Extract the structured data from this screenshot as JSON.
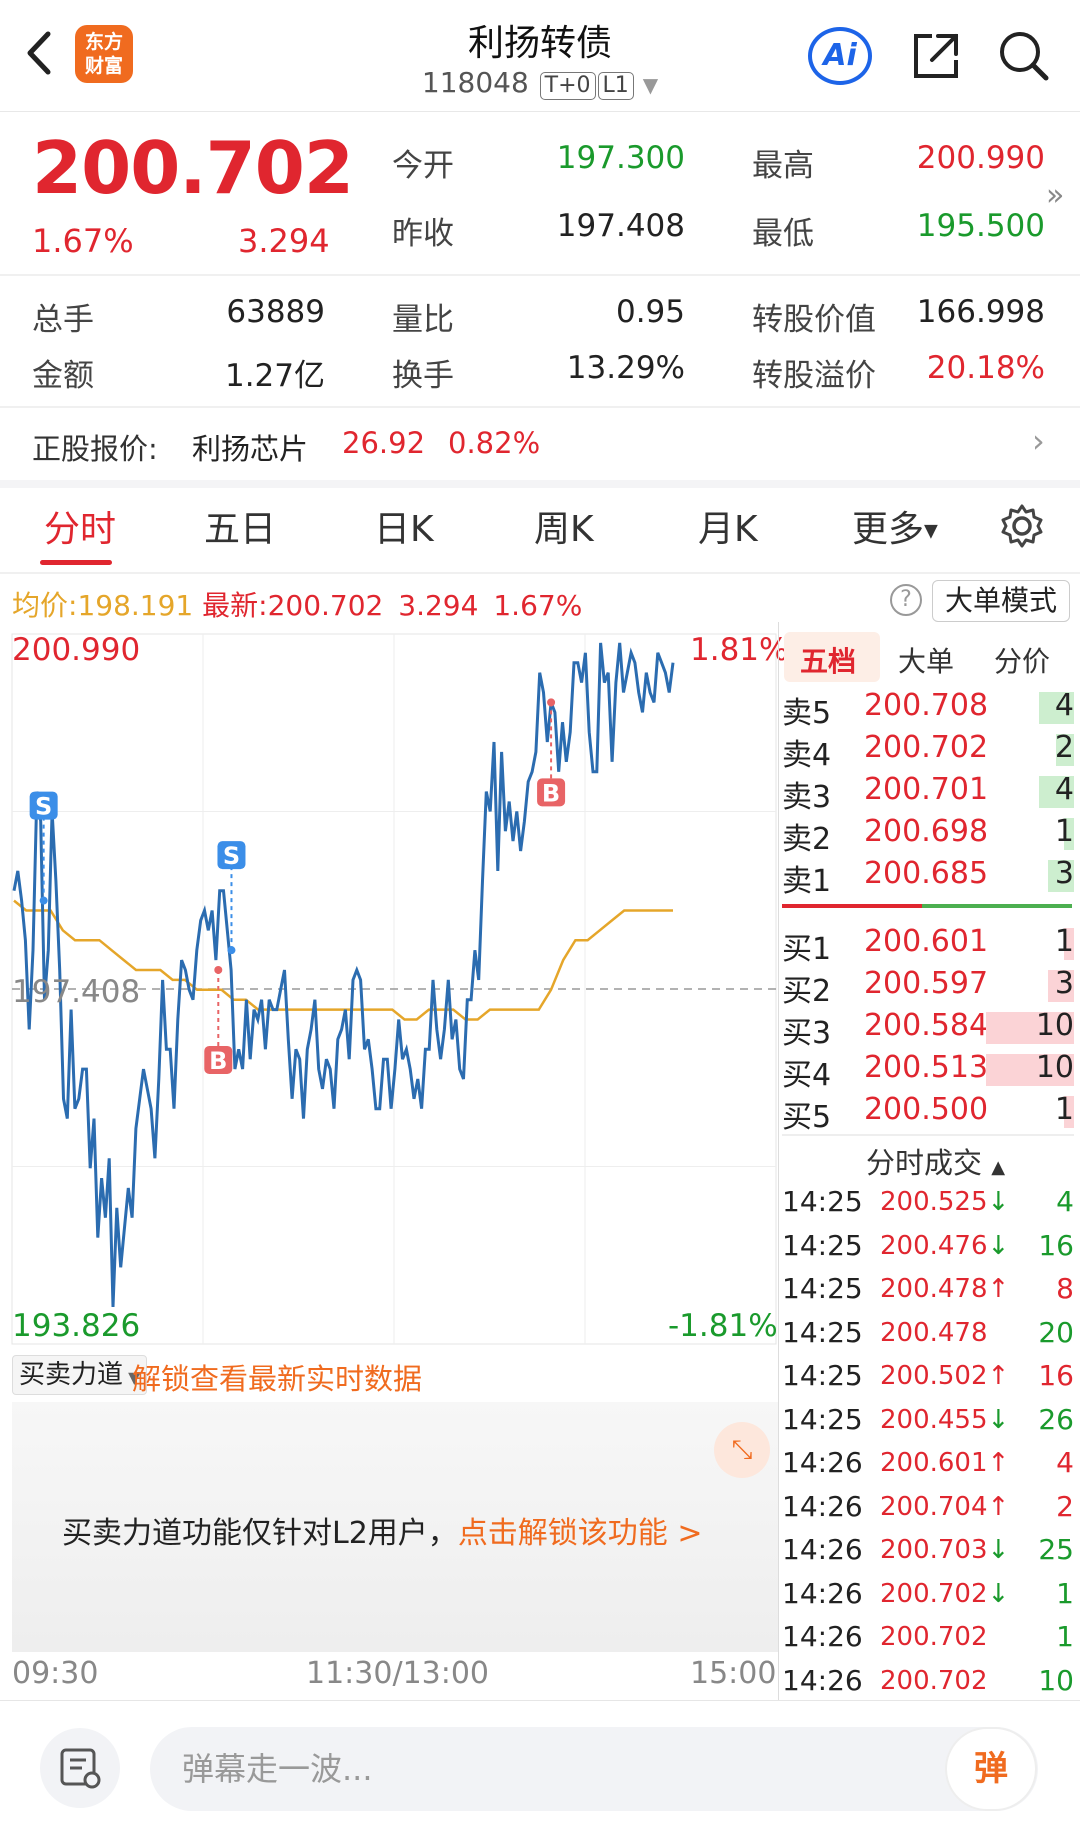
{
  "header": {
    "title": "利扬转债",
    "code": "118048",
    "tag1": "T+0",
    "tag2": "L1",
    "logo_line1": "东方",
    "logo_line2": "财富",
    "ai_label": "Ai"
  },
  "quote": {
    "price": "200.702",
    "change_pct": "1.67%",
    "change_val": "3.294",
    "open_label": "今开",
    "open": "197.300",
    "high_label": "最高",
    "high": "200.990",
    "prevclose_label": "昨收",
    "prevclose": "197.408",
    "low_label": "最低",
    "low": "195.500",
    "volume_label": "总手",
    "volume": "63889",
    "volratio_label": "量比",
    "volratio": "0.95",
    "convvalue_label": "转股价值",
    "convvalue": "166.998",
    "amount_label": "金额",
    "amount": "1.27亿",
    "turnover_label": "换手",
    "turnover": "13.29%",
    "premium_label": "转股溢价",
    "premium": "20.18%"
  },
  "stock": {
    "label": "正股报价:",
    "name": "利扬芯片",
    "price": "26.92",
    "change": "0.82%"
  },
  "tabs": [
    "分时",
    "五日",
    "日K",
    "周K",
    "月K",
    "更多"
  ],
  "infoline": {
    "avg_label": "均价:",
    "avg": "198.191",
    "latest_label": "最新:",
    "latest": "200.702",
    "change": "3.294",
    "pct": "1.67%",
    "bigorder_mode": "大单模式"
  },
  "chart_labels": {
    "y_top": "200.990",
    "y_mid": "197.408",
    "y_bottom": "193.826",
    "pct_top": "1.81%",
    "pct_bottom": "-1.81%",
    "time_start": "09:30",
    "time_mid": "11:30/13:00",
    "time_end": "15:00",
    "marker_s": "S",
    "marker_b": "B"
  },
  "chart_data": {
    "type": "line",
    "ylim": [
      193.826,
      200.99
    ],
    "prev_close": 197.408,
    "series": [
      {
        "values": [
          198.4,
          198.6,
          198.3,
          197.9,
          197.0,
          197.8,
          199.4,
          199.1,
          197.3,
          197.8,
          199.2,
          198.5,
          197.6,
          196.3,
          196.1,
          197.2,
          196.2,
          196.3,
          196.6,
          196.6,
          195.6,
          196.1,
          194.9,
          195.5,
          195.1,
          195.7,
          194.2,
          195.2,
          194.6,
          195.0,
          195.4,
          195.1,
          196.0,
          196.3,
          196.6,
          196.4,
          196.2,
          195.7,
          196.5,
          197.5,
          196.8,
          196.8,
          196.2,
          197.1,
          197.7,
          197.6,
          197.4,
          197.3,
          197.8,
          198.1,
          198.2,
          198.0,
          198.2,
          197.7,
          198.4,
          198.4,
          198.0,
          197.6,
          196.6,
          196.8,
          196.6,
          197.3,
          196.7,
          197.2,
          197.1,
          197.3,
          196.8,
          197.3,
          197.2,
          197.2,
          197.4,
          197.6,
          196.9,
          196.3,
          196.8,
          196.7,
          196.1,
          196.8,
          197.0,
          197.3,
          196.6,
          196.4,
          196.7,
          196.6,
          196.2,
          196.9,
          197.0,
          197.2,
          196.7,
          197.5,
          197.6,
          197.5,
          196.8,
          196.9,
          196.6,
          196.2,
          196.2,
          196.7,
          196.7,
          196.2,
          196.6,
          197.1,
          196.7,
          196.8,
          196.6,
          196.3,
          196.5,
          196.2,
          196.8,
          196.8,
          197.5,
          197.0,
          196.7,
          197.0,
          197.5,
          196.9,
          197.1,
          196.6,
          196.5,
          197.3,
          197.3,
          197.8,
          197.5,
          198.5,
          199.4,
          199.2,
          199.9,
          198.6,
          199.8,
          199.0,
          199.3,
          198.9,
          199.2,
          198.8,
          199.1,
          199.5,
          199.6,
          199.8,
          200.6,
          200.4,
          199.9,
          200.3,
          200.2,
          199.6,
          200.1,
          199.7,
          200.0,
          200.7,
          200.7,
          200.5,
          200.8,
          200.0,
          199.6,
          199.6,
          200.9,
          200.5,
          200.6,
          199.7,
          200.5,
          200.9,
          200.4,
          200.6,
          200.8,
          200.7,
          200.4,
          200.2,
          200.6,
          200.4,
          200.3,
          200.8,
          200.7,
          200.6,
          200.4,
          200.7
        ]
      },
      {
        "name": "均价",
        "values": [
          198.3,
          198.2,
          198.2,
          198.2,
          198.0,
          197.9,
          197.9,
          197.9,
          197.8,
          197.7,
          197.6,
          197.6,
          197.6,
          197.5,
          197.5,
          197.4,
          197.4,
          197.4,
          197.3,
          197.3,
          197.2,
          197.2,
          197.2,
          197.2,
          197.2,
          197.2,
          197.2,
          197.2,
          197.2,
          197.2,
          197.2,
          197.2,
          197.1,
          197.1,
          197.2,
          197.2,
          197.2,
          197.1,
          197.1,
          197.2,
          197.2,
          197.2,
          197.2,
          197.2,
          197.4,
          197.7,
          197.9,
          197.9,
          198.0,
          198.1,
          198.2,
          198.2,
          198.2,
          198.2,
          198.2
        ]
      }
    ],
    "markers": [
      {
        "label": "S",
        "value": 198.3
      },
      {
        "label": "S",
        "value": 197.8
      },
      {
        "label": "B",
        "value": 197.6
      },
      {
        "label": "B",
        "value": 200.3
      }
    ]
  },
  "right_panel": {
    "tabs": [
      "五档",
      "大单",
      "分价"
    ],
    "asks": [
      {
        "label": "卖5",
        "price": "200.708",
        "vol": "4"
      },
      {
        "label": "卖4",
        "price": "200.702",
        "vol": "2"
      },
      {
        "label": "卖3",
        "price": "200.701",
        "vol": "4"
      },
      {
        "label": "卖2",
        "price": "200.698",
        "vol": "1"
      },
      {
        "label": "卖1",
        "price": "200.685",
        "vol": "3"
      }
    ],
    "bids": [
      {
        "label": "买1",
        "price": "200.601",
        "vol": "1"
      },
      {
        "label": "买2",
        "price": "200.597",
        "vol": "3"
      },
      {
        "label": "买3",
        "price": "200.584",
        "vol": "10"
      },
      {
        "label": "买4",
        "price": "200.513",
        "vol": "10"
      },
      {
        "label": "买5",
        "price": "200.500",
        "vol": "1"
      }
    ],
    "ticks_title": "分时成交",
    "ticks": [
      {
        "time": "14:25",
        "price": "200.525",
        "dir": "↓",
        "vol": "4"
      },
      {
        "time": "14:25",
        "price": "200.476",
        "dir": "↓",
        "vol": "16"
      },
      {
        "time": "14:25",
        "price": "200.478",
        "dir": "↑",
        "vol": "8"
      },
      {
        "time": "14:25",
        "price": "200.478",
        "dir": "",
        "vol": "20"
      },
      {
        "time": "14:25",
        "price": "200.502",
        "dir": "↑",
        "vol": "16"
      },
      {
        "time": "14:25",
        "price": "200.455",
        "dir": "↓",
        "vol": "26"
      },
      {
        "time": "14:26",
        "price": "200.601",
        "dir": "↑",
        "vol": "4"
      },
      {
        "time": "14:26",
        "price": "200.704",
        "dir": "↑",
        "vol": "2"
      },
      {
        "time": "14:26",
        "price": "200.703",
        "dir": "↓",
        "vol": "25"
      },
      {
        "time": "14:26",
        "price": "200.702",
        "dir": "↓",
        "vol": "1"
      },
      {
        "time": "14:26",
        "price": "200.702",
        "dir": "",
        "vol": "1"
      },
      {
        "time": "14:26",
        "price": "200.702",
        "dir": "",
        "vol": "10"
      }
    ]
  },
  "lower_panel": {
    "selector": "买卖力道",
    "unlock_link": "解锁查看最新实时数据",
    "notice": "买卖力道功能仅针对L2用户，",
    "notice_link": "点击解锁该功能 >"
  },
  "bottom": {
    "placeholder": "弹幕走一波...",
    "send": "弹"
  },
  "colors": {
    "red": "#e0262f",
    "green": "#1a9a2c",
    "blue_line": "#2b6cb0",
    "avg_line": "#e5a62a",
    "brand": "#f06b1f"
  }
}
